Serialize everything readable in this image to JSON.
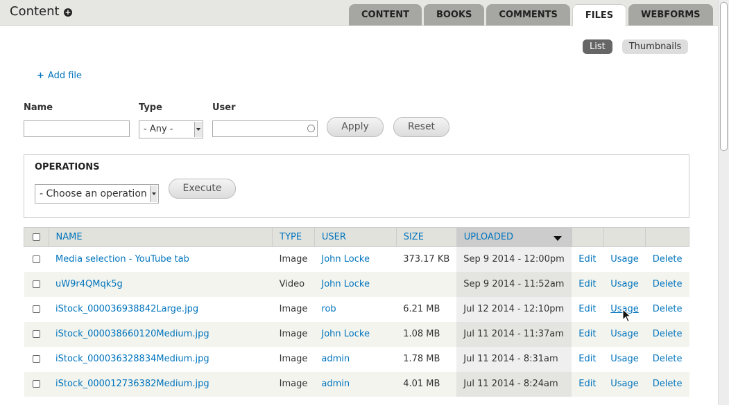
{
  "header": {
    "title": "Content",
    "add_icon": "plus-circle-icon"
  },
  "tabs": [
    {
      "label": "CONTENT",
      "active": false
    },
    {
      "label": "BOOKS",
      "active": false
    },
    {
      "label": "COMMENTS",
      "active": false
    },
    {
      "label": "FILES",
      "active": true
    },
    {
      "label": "WEBFORMS",
      "active": false
    }
  ],
  "view_toggle": {
    "list": "List",
    "thumbnails": "Thumbnails"
  },
  "add_file": {
    "icon": "+",
    "label": "Add file"
  },
  "filters": {
    "name_label": "Name",
    "type_label": "Type",
    "type_value": "- Any -",
    "user_label": "User",
    "apply": "Apply",
    "reset": "Reset"
  },
  "operations": {
    "title": "OPERATIONS",
    "select_value": "- Choose an operation -",
    "execute": "Execute"
  },
  "table": {
    "headers": {
      "name": "NAME",
      "type": "TYPE",
      "user": "USER",
      "size": "SIZE",
      "uploaded": "UPLOADED"
    },
    "rows": [
      {
        "name": "Media selection - YouTube tab",
        "type": "Image",
        "user": "John Locke",
        "size": "373.17 KB",
        "uploaded": "Sep 9 2014 - 12:00pm",
        "edit": "Edit",
        "usage": "Usage",
        "delete": "Delete"
      },
      {
        "name": "uW9r4QMqk5g",
        "type": "Video",
        "user": "John Locke",
        "size": "",
        "uploaded": "Sep 9 2014 - 11:52am",
        "edit": "Edit",
        "usage": "Usage",
        "delete": "Delete"
      },
      {
        "name": "iStock_000036938842Large.jpg",
        "type": "Image",
        "user": "rob",
        "size": "6.21 MB",
        "uploaded": "Jul 12 2014 - 12:10pm",
        "edit": "Edit",
        "usage": "Usage",
        "delete": "Delete"
      },
      {
        "name": "iStock_000038660120Medium.jpg",
        "type": "Image",
        "user": "John Locke",
        "size": "1.08 MB",
        "uploaded": "Jul 11 2014 - 11:37am",
        "edit": "Edit",
        "usage": "Usage",
        "delete": "Delete"
      },
      {
        "name": "iStock_000036328834Medium.jpg",
        "type": "Image",
        "user": "admin",
        "size": "1.78 MB",
        "uploaded": "Jul 11 2014 - 8:31am",
        "edit": "Edit",
        "usage": "Usage",
        "delete": "Delete"
      },
      {
        "name": "iStock_000012736382Medium.jpg",
        "type": "Image",
        "user": "admin",
        "size": "4.01 MB",
        "uploaded": "Jul 11 2014 - 8:24am",
        "edit": "Edit",
        "usage": "Usage",
        "delete": "Delete"
      }
    ]
  },
  "colors": {
    "link": "#0074bd",
    "active_tab_bg": "#ffffff",
    "inactive_tab_bg": "#a6a7a2"
  }
}
